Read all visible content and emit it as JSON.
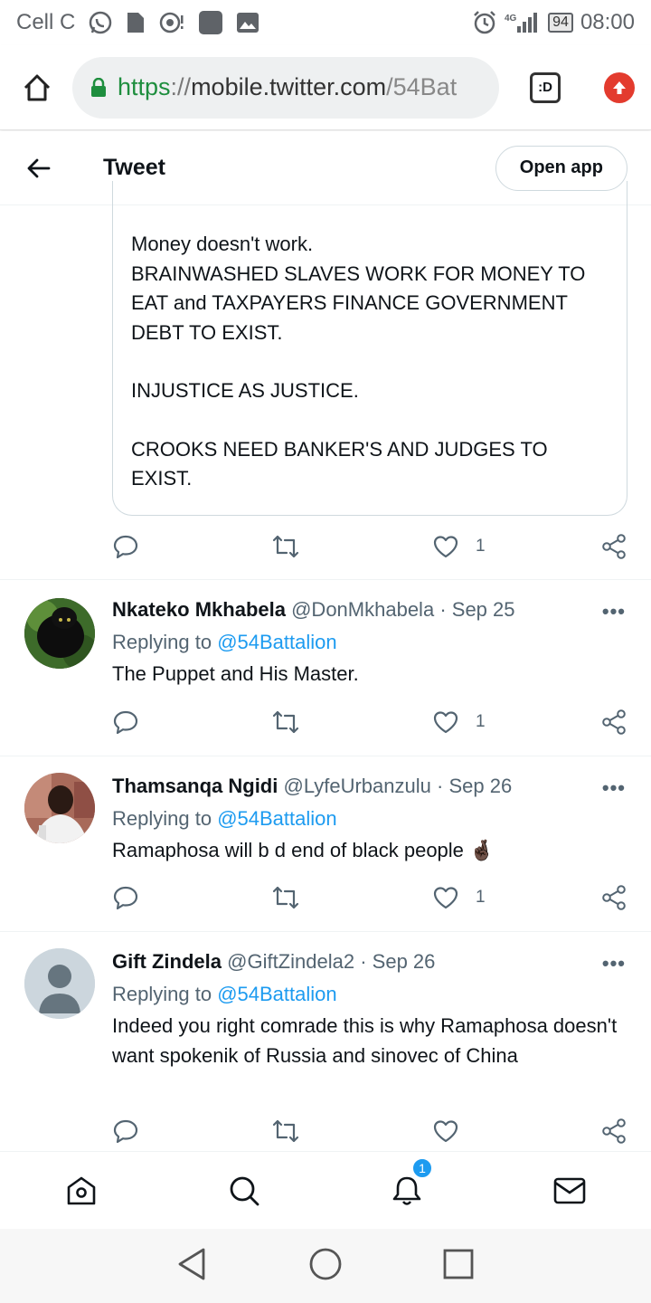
{
  "status_bar": {
    "carrier": "Cell C",
    "network": "4G",
    "battery": "94",
    "time": "08:00"
  },
  "browser": {
    "url_scheme": "https",
    "url_sep": "://",
    "url_host": "mobile.twitter.com",
    "url_path": "/54Bat",
    "tab_label": ":D"
  },
  "header": {
    "title": "Tweet",
    "open_app": "Open app"
  },
  "quoted_tweet": {
    "line1": "Money doesn't work.",
    "line2": "BRAINWASHED SLAVES WORK FOR MONEY TO EAT and TAXPAYERS FINANCE GOVERNMENT DEBT TO EXIST.",
    "line3": "INJUSTICE AS JUSTICE.",
    "line4": "CROOKS NEED BANKER'S AND JUDGES TO EXIST.",
    "like_count": "1"
  },
  "replies": [
    {
      "name": "Nkateko Mkhabela",
      "handle": "@DonMkhabela",
      "date": "Sep 25",
      "replying_prefix": "Replying to",
      "replying_to": "@54Battalion",
      "text": "The Puppet and His Master.",
      "like_count": "1"
    },
    {
      "name": "Thamsanqa Ngidi",
      "handle": "@LyfeUrbanzulu",
      "date": "Sep 26",
      "replying_prefix": "Replying to",
      "replying_to": "@54Battalion",
      "text": "Ramaphosa will b d end of black people 🤞🏿",
      "like_count": "1"
    },
    {
      "name": "Gift Zindela",
      "handle": "@GiftZindela2",
      "date": "Sep 26",
      "replying_prefix": "Replying to",
      "replying_to": "@54Battalion",
      "text": "Indeed you right comrade this is why Ramaphosa doesn't want spokenik of Russia  and sinovec of China",
      "like_count": ""
    }
  ],
  "common": {
    "dot": "·",
    "more": "•••"
  },
  "bottom_nav": {
    "notification_badge": "1"
  },
  "colors": {
    "link": "#1d9bf0",
    "secure_green": "#1e8e3e",
    "update_red": "#e33b2e",
    "muted": "#536471"
  }
}
